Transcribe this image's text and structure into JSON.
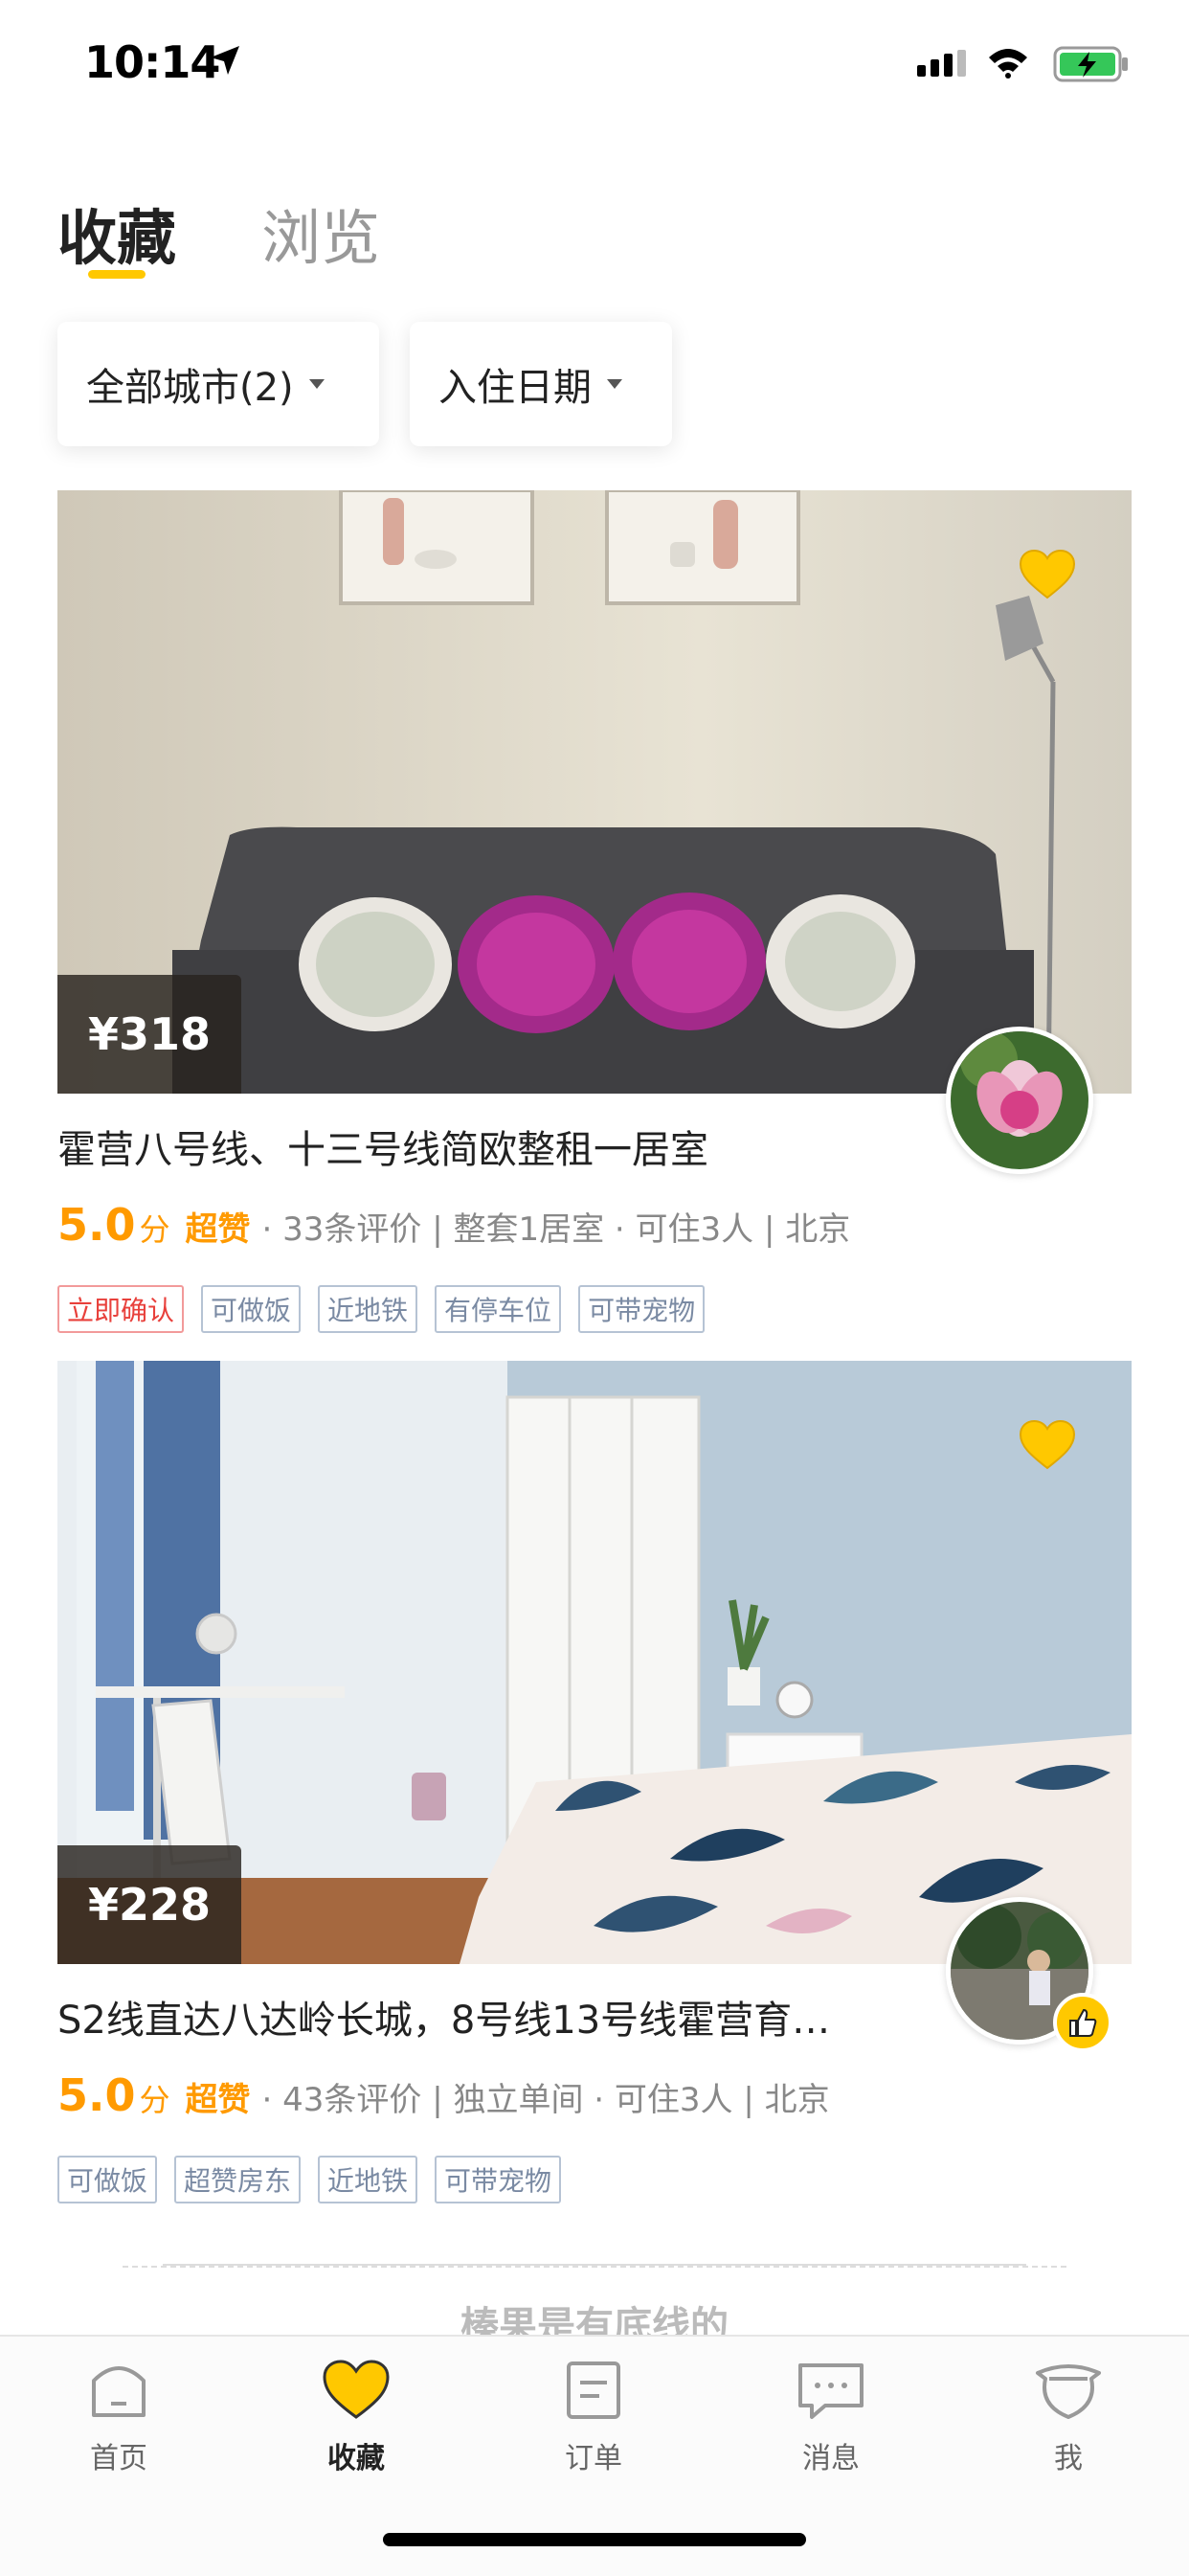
{
  "status_bar": {
    "time": "10:14"
  },
  "tabs": [
    {
      "label": "收藏",
      "active": true
    },
    {
      "label": "浏览",
      "active": false
    }
  ],
  "filters": {
    "city": "全部城市(2)",
    "date": "入住日期"
  },
  "listings": [
    {
      "price": "¥318",
      "title": "霍营八号线、十三号线简欧整租一居室",
      "score": "5.0",
      "score_unit": "分",
      "super_label": "超赞",
      "meta": "· 33条评价 | 整套1居室 · 可住3人 | 北京",
      "tags": [
        "立即确认",
        "可做饭",
        "近地铁",
        "有停车位",
        "可带宠物"
      ]
    },
    {
      "price": "¥228",
      "title": "S2线直达八达岭长城，8号线13号线霍营育…",
      "score": "5.0",
      "score_unit": "分",
      "super_label": "超赞",
      "meta": "· 43条评价 | 独立单间 · 可住3人 | 北京",
      "tags": [
        "可做饭",
        "超赞房东",
        "近地铁",
        "可带宠物"
      ]
    }
  ],
  "end_text": "榛果是有底线的",
  "tab_bar": [
    {
      "label": "首页",
      "icon": "home-icon",
      "active": false
    },
    {
      "label": "收藏",
      "icon": "heart-icon",
      "active": true
    },
    {
      "label": "订单",
      "icon": "order-icon",
      "active": false
    },
    {
      "label": "消息",
      "icon": "message-icon",
      "active": false
    },
    {
      "label": "我",
      "icon": "profile-icon",
      "active": false
    }
  ],
  "colors": {
    "accent": "#ffc800",
    "score": "#ff9a00",
    "tag_red": "#e8403b",
    "tag_blue": "#7a8aa3"
  }
}
